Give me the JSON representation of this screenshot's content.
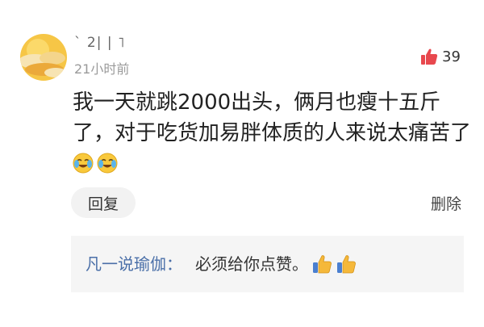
{
  "comment": {
    "username": "` 2| |  ˥",
    "timestamp": "21小时前",
    "like_count": "39",
    "text": "我一天就跳2000出头，俩月也瘦十五斤了，对于吃货加易胖体质的人来说太痛苦了",
    "emojis": [
      "cry-laugh-emoji",
      "cry-laugh-emoji"
    ],
    "reply_label": "回复",
    "delete_label": "删除"
  },
  "reply": {
    "author": "凡一说瑜伽：",
    "text": "必须给你点赞。",
    "emojis": [
      "thumbs-up-emoji",
      "thumbs-up-emoji"
    ]
  },
  "colors": {
    "like_icon": "#e8484e",
    "reply_author": "#4a6fa8",
    "reply_bg": "#f5f5f5",
    "reply_button_bg": "#f2f2f2",
    "avatar_sky": "#f6c646",
    "avatar_cloud": "#f7e4b3"
  }
}
